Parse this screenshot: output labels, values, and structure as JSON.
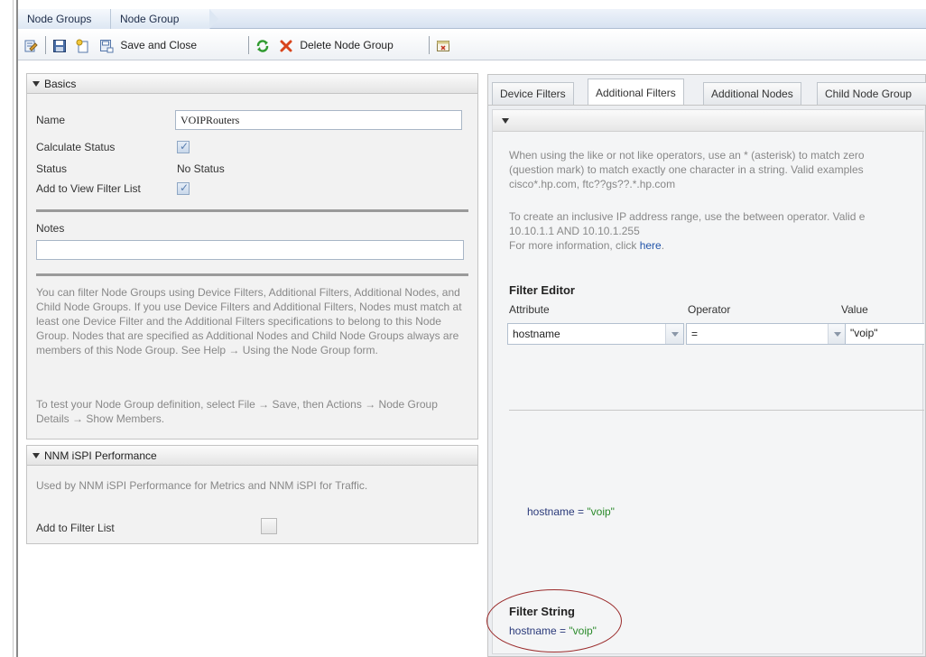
{
  "breadcrumb": {
    "items": [
      "Node Groups",
      "Node Group"
    ]
  },
  "toolbar": {
    "save_close_label": "Save and Close",
    "delete_label": "Delete Node Group",
    "icons": [
      "edit-icon",
      "save-icon",
      "new-icon",
      "save-close-icon",
      "refresh-icon",
      "delete-icon",
      "close-form-icon"
    ]
  },
  "basics": {
    "title": "Basics",
    "name_label": "Name",
    "name_value": "VOIPRouters",
    "calc_status_label": "Calculate Status",
    "calc_status_checked": true,
    "status_label": "Status",
    "status_value": "No Status",
    "add_view_filter_label": "Add to View Filter List",
    "add_view_filter_checked": true,
    "notes_label": "Notes",
    "notes_value": "",
    "help_text_1": "You can filter Node Groups using Device Filters, Additional Filters, Additional Nodes, and Child Node Groups. If you use Device Filters and Additional Filters, Nodes must match at least one Device Filter and the Additional Filters specifications to belong to this Node Group. Nodes that are specified as Additional Nodes and Child Node Groups always are members of this Node Group. See Help → Using the Node Group form.",
    "help_text_2": "To test your Node Group definition, select File → Save, then Actions → Node Group Details → Show Members."
  },
  "ispi": {
    "title": "NNM iSPI Performance",
    "description": "Used by NNM iSPI Performance for Metrics and NNM iSPI for Traffic.",
    "add_filter_label": "Add to Filter List",
    "add_filter_checked": false
  },
  "tabs": [
    "Device Filters",
    "Additional Filters",
    "Additional Nodes",
    "Child Node Group"
  ],
  "active_tab": "Additional Filters",
  "filters": {
    "info_lines": [
      "When using the like or not like operators, use an * (asterisk) to match zero",
      "(question mark) to match exactly one character in a string. Valid examples",
      "cisco*.hp.com, ftc??gs??.*.hp.com"
    ],
    "range_lines": [
      "To create an inclusive IP address range, use the between operator. Valid e",
      "10.10.1.1 AND 10.10.1.255"
    ],
    "more_info_prefix": "For more information, click ",
    "more_info_link": "here",
    "more_info_suffix": ".",
    "editor_title": "Filter Editor",
    "attribute_label": "Attribute",
    "operator_label": "Operator",
    "value_label": "Value",
    "attribute_value": "hostname",
    "operator_value": "=",
    "value_value": "\"voip\"",
    "expression_attr": "hostname",
    "expression_op": " = ",
    "expression_val": "\"voip\"",
    "filter_string_title": "Filter String",
    "filter_string_attr": "hostname",
    "filter_string_op": " = ",
    "filter_string_val": "\"voip\""
  },
  "colors": {
    "link": "#2255aa",
    "annotation_circle": "#9a2a2a"
  }
}
